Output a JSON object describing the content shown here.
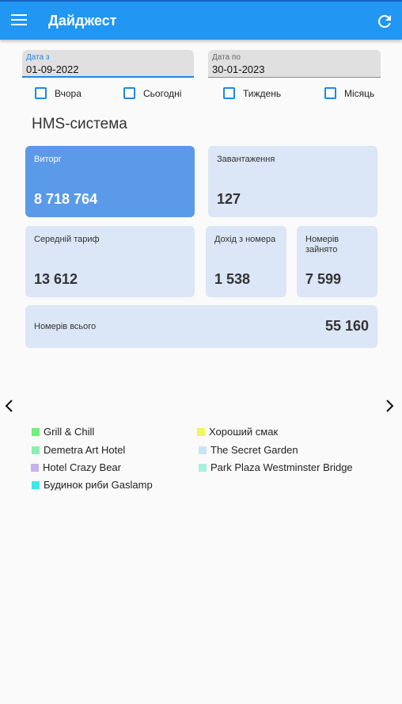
{
  "appbar": {
    "title": "Дайджест"
  },
  "filters": {
    "date_from": {
      "label": "Дата з",
      "value": "01-09-2022"
    },
    "date_to": {
      "label": "Дата по",
      "value": "30-01-2023"
    },
    "checkboxes": [
      {
        "label": "Вчора",
        "checked": false
      },
      {
        "label": "Сьогодні",
        "checked": false
      },
      {
        "label": "Тиждень",
        "checked": false
      },
      {
        "label": "Місяць",
        "checked": false
      }
    ]
  },
  "section": {
    "title": "HMS-система"
  },
  "cards": {
    "revenue": {
      "label": "Виторг",
      "value": "8 718 764"
    },
    "load": {
      "label": "Завантаження",
      "value": "127"
    },
    "avg_rate": {
      "label": "Середній тариф",
      "value": "13 612"
    },
    "income_per_room": {
      "label": "Дохід з номера",
      "value": "1 538"
    },
    "rooms_occupied": {
      "label": "Номерів зайнято",
      "value": "7 599"
    },
    "rooms_total": {
      "label": "Номерів всього",
      "value": "55 160"
    }
  },
  "legend": [
    {
      "label": "Grill & Chill",
      "color": "#6ef07a"
    },
    {
      "label": "Хороший смак",
      "color": "#f0f75a"
    },
    {
      "label": "Demetra Art Hotel",
      "color": "#8cefb0"
    },
    {
      "label": "The Secret Garden",
      "color": "#c6e5f7"
    },
    {
      "label": "Hotel Crazy Bear",
      "color": "#c6b0ee"
    },
    {
      "label": "Park Plaza Westminster Bridge",
      "color": "#a6f0e0"
    },
    {
      "label": "Будинок риби Gaslamp",
      "color": "#3ce8e8"
    }
  ],
  "colors": {
    "accent": "#2196f3",
    "card": "#dbe6f6",
    "card_primary": "#5a9ae8"
  },
  "icons": {
    "menu": "hamburger-icon",
    "refresh": "refresh-icon",
    "prev": "chevron-left-icon",
    "next": "chevron-right-icon"
  }
}
